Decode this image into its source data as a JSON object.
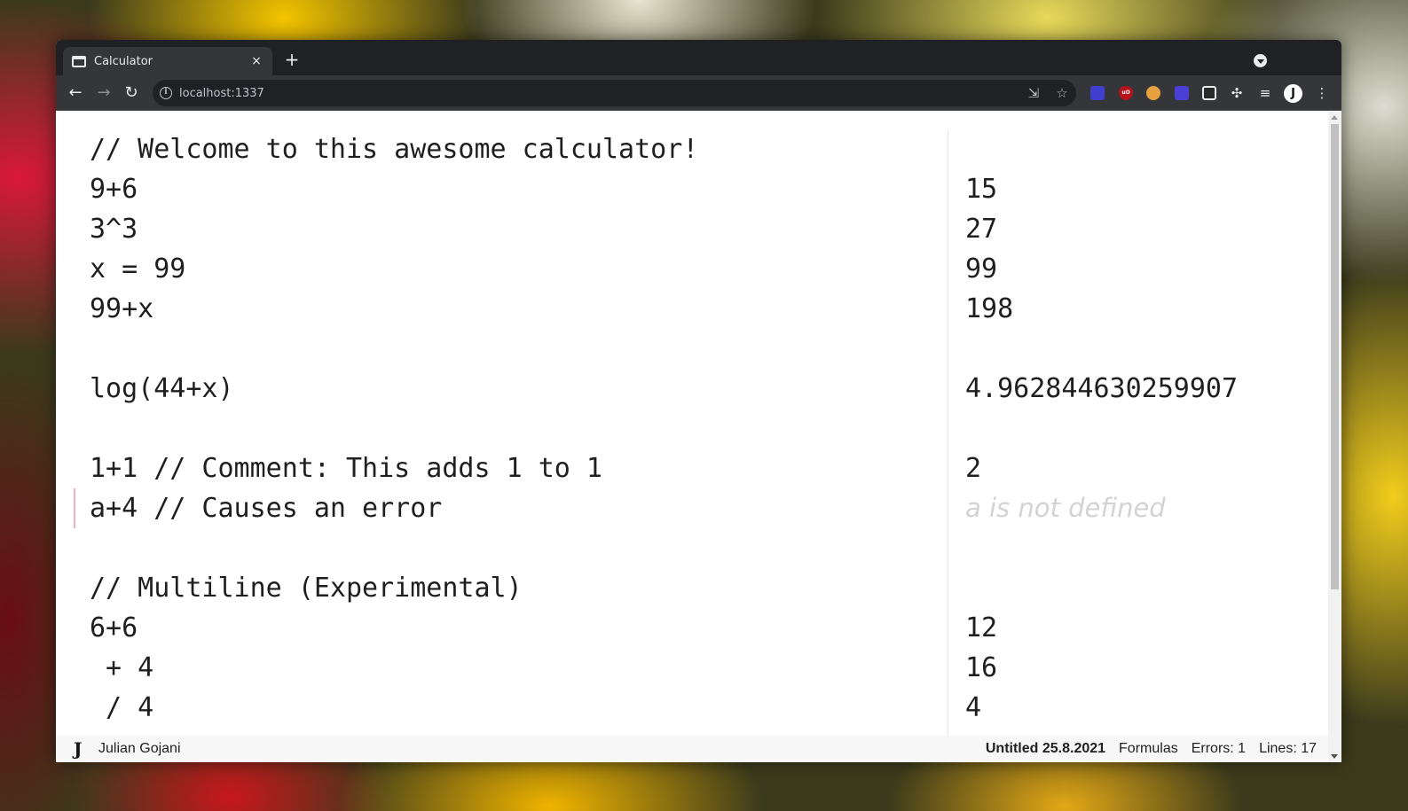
{
  "browser": {
    "tab_title": "Calculator",
    "tab_close": "×",
    "new_tab": "+",
    "url": "localhost:1337",
    "avatar_initial": "J",
    "icons": {
      "back": "arrow-left-icon",
      "forward": "arrow-right-icon",
      "reload": "reload-icon",
      "info": "info-icon",
      "install": "install-icon",
      "bookmark": "star-icon",
      "extensions": "puzzle-icon",
      "media": "media-queue-icon",
      "menu": "kebab-menu-icon"
    }
  },
  "calculator": {
    "lines": [
      {
        "expr": "// Welcome to this awesome calculator!",
        "result": ""
      },
      {
        "expr": "9+6",
        "result": "15"
      },
      {
        "expr": "3^3",
        "result": "27"
      },
      {
        "expr": "x = 99",
        "result": "99"
      },
      {
        "expr": "99+x",
        "result": "198"
      },
      {
        "expr": "",
        "result": ""
      },
      {
        "expr": "log(44+x)",
        "result": "4.962844630259907"
      },
      {
        "expr": "",
        "result": ""
      },
      {
        "expr": "1+1 // Comment: This adds 1 to 1",
        "result": "2"
      },
      {
        "expr": "a+4 // Causes an error",
        "result": "a is not defined"
      },
      {
        "expr": "",
        "result": ""
      },
      {
        "expr": "// Multiline (Experimental)",
        "result": ""
      },
      {
        "expr": "6+6",
        "result": "12"
      },
      {
        "expr": " + 4",
        "result": "16"
      },
      {
        "expr": " / 4",
        "result": "4"
      }
    ],
    "error_color": "#f3b0b6"
  },
  "footer": {
    "logo": "J",
    "user": "Julian Gojani",
    "file": "Untitled 25.8.2021",
    "mode": "Formulas",
    "errors": "Errors: 1",
    "lines": "Lines: 17"
  }
}
